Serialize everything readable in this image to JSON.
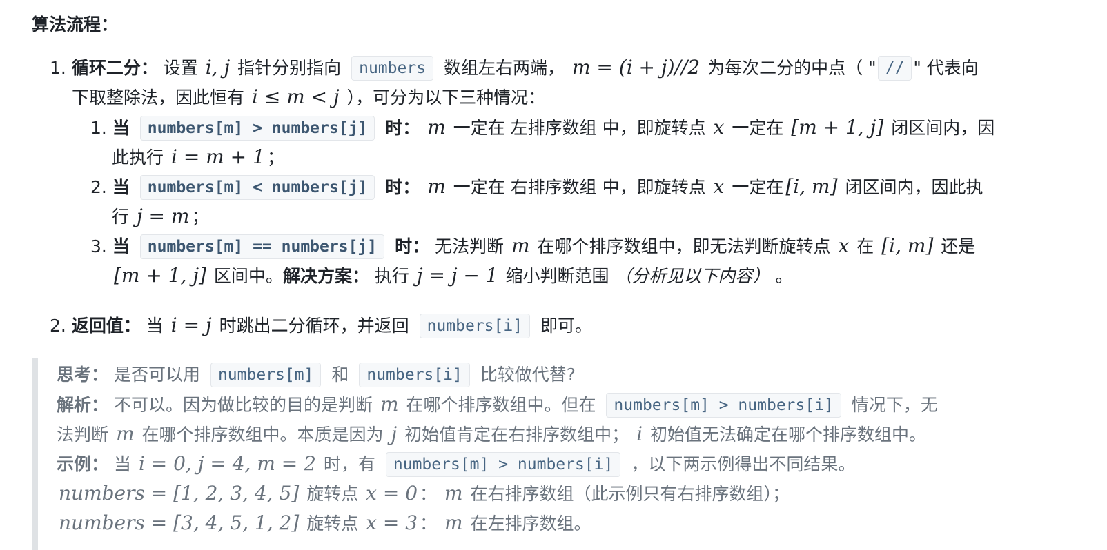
{
  "title": "算法流程：",
  "step1": {
    "num": "1.",
    "label": "循环二分：",
    "t1": "设置",
    "m1": "i, j",
    "t2": "指针分别指向",
    "c1": "numbers",
    "t3": "数组左右两端，",
    "m2": "m = (i + j)//2",
    "t4": "为每次二分的中点（ \"",
    "c2": "//",
    "t5": "\" 代表向",
    "l2t1": "下取整除法，因此恒有",
    "l2m1": "i ≤ m < j",
    "l2t2": "），可分为以下三种情况："
  },
  "cases": [
    {
      "num": "1.",
      "dang": "当",
      "code": "numbers[m] > numbers[j]",
      "shi": "时：",
      "m1": "m",
      "t1": "一定在 左排序数组 中，即旋转点",
      "m2": "x",
      "t2": "一定在",
      "m3": "[m + 1, j]",
      "t3": "闭区间内，因",
      "l2t1": "此执行",
      "l2m1": "i = m + 1",
      "l2t2": "；"
    },
    {
      "num": "2.",
      "dang": "当",
      "code": "numbers[m] < numbers[j]",
      "shi": "时：",
      "m1": "m",
      "t1": "一定在 右排序数组 中，即旋转点",
      "m2": "x",
      "t2": "一定在",
      "m3": "[i, m]",
      "t3": "闭区间内，因此执",
      "l2t1": "行",
      "l2m1": "j = m",
      "l2t2": "；"
    },
    {
      "num": "3.",
      "dang": "当",
      "code": "numbers[m] == numbers[j]",
      "shi": "时：",
      "t1": "无法判断",
      "m1": "m",
      "t2": "在哪个排序数组中，即无法判断旋转点",
      "m2": "x",
      "t3": "在",
      "m3": "[i, m]",
      "t4": "还是",
      "l2m1": "[m + 1, j]",
      "l2t1": "区间中。",
      "l2b": "解决方案：",
      "l2t2": "执行",
      "l2m2": "j = j − 1",
      "l2t3": "缩小判断范围",
      "l2it": "（分析见以下内容）",
      "l2t4": "。"
    }
  ],
  "step2": {
    "num": "2.",
    "label": "返回值：",
    "t1": "当",
    "m1": "i = j",
    "t2": "时跳出二分循环，并返回",
    "c1": "numbers[i]",
    "t3": "即可。"
  },
  "quote": {
    "q1": {
      "label": "思考：",
      "t1": "是否可以用",
      "c1": "numbers[m]",
      "t2": "和",
      "c2": "numbers[i]",
      "t3": "比较做代替?"
    },
    "q2": {
      "label": "解析：",
      "t1": "不可以。因为做比较的目的是判断",
      "m1": "m",
      "t2": "在哪个排序数组中。但在",
      "c1": "numbers[m] > numbers[i]",
      "t3": "情况下，无",
      "l2t1": "法判断",
      "l2m1": "m",
      "l2t2": "在哪个排序数组中。本质是因为",
      "l2m2": "j",
      "l2t3": "初始值肯定在右排序数组中；",
      "l2m3": "i",
      "l2t4": "初始值无法确定在哪个排序数组中。"
    },
    "q3": {
      "label": "示例：",
      "t1": "当",
      "m1": "i = 0, j = 4, m = 2",
      "t2": "时，有",
      "c1": "numbers[m] > numbers[i]",
      "t3": "，以下两示例得出不同结果。"
    },
    "q4": {
      "m1": "numbers = [1, 2, 3, 4, 5]",
      "t1": "旋转点",
      "m2": "x = 0",
      "t2": "：",
      "m3": "m",
      "t3": "在右排序数组（此示例只有右排序数组）；"
    },
    "q5": {
      "m1": "numbers = [3, 4, 5, 1, 2]",
      "t1": "旋转点",
      "m2": "x = 3",
      "t2": "：",
      "m3": "m",
      "t3": "在左排序数组。"
    }
  }
}
